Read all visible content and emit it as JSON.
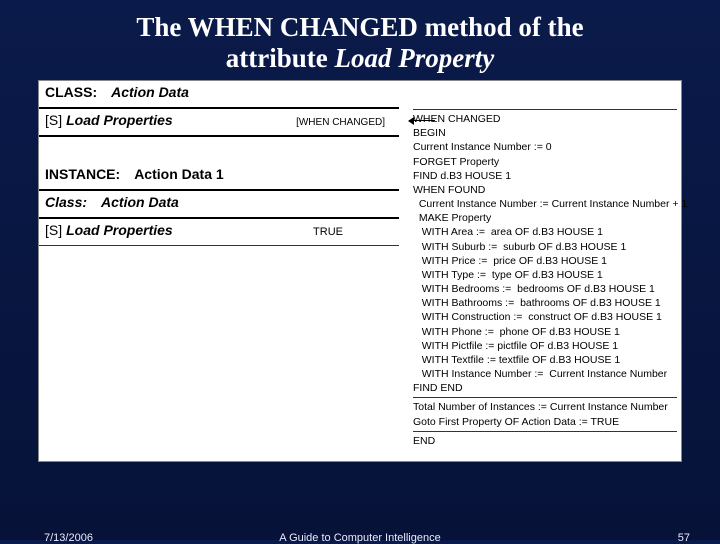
{
  "title_a": "The WHEN CHANGED method of the",
  "title_b": "attribute",
  "title_c": "Load Property",
  "class_lbl": "CLASS:",
  "class_val": "Action Data",
  "slot1_pre": "[S]",
  "slot1_name": "Load Properties",
  "slot1_tag": "[WHEN CHANGED]",
  "inst_lbl": "INSTANCE:",
  "inst_val": "Action Data 1",
  "cls2_lbl": "Class:",
  "cls2_val": "Action Data",
  "slot2_pre": "[S]",
  "slot2_name": "Load Properties",
  "slot2_val": "TRUE",
  "code": {
    "l0": "WHEN CHANGED",
    "l1": "BEGIN",
    "l2": "Current Instance Number := 0",
    "l3": "FORGET Property",
    "l4": "FIND d.B3 HOUSE 1",
    "l5": "WHEN FOUND",
    "l6": "  Current Instance Number := Current Instance Number + 1",
    "l7": "  MAKE Property",
    "l8": "   WITH Area :=  area OF d.B3 HOUSE 1",
    "l9": "   WITH Suburb :=  suburb OF d.B3 HOUSE 1",
    "l10": "   WITH Price :=  price OF d.B3 HOUSE 1",
    "l11": "   WITH Type :=  type OF d.B3 HOUSE 1",
    "l12": "   WITH Bedrooms :=  bedrooms OF d.B3 HOUSE 1",
    "l13": "   WITH Bathrooms :=  bathrooms OF d.B3 HOUSE 1",
    "l14": "   WITH Construction :=  construct OF d.B3 HOUSE 1",
    "l15": "   WITH Phone :=  phone OF d.B3 HOUSE 1",
    "l16": "   WITH Pictfile := pictfile OF d.B3 HOUSE 1",
    "l17": "   WITH Textfile := textfile OF d.B3 HOUSE 1",
    "l18": "   WITH Instance Number :=  Current Instance Number",
    "l19": "FIND END",
    "l20": "Total Number of Instances := Current Instance Number",
    "l21": "Goto First Property OF Action Data := TRUE",
    "l22": "END"
  },
  "footer_date": "7/13/2006",
  "footer_center": "A Guide to Computer Intelligence",
  "footer_page": "57"
}
